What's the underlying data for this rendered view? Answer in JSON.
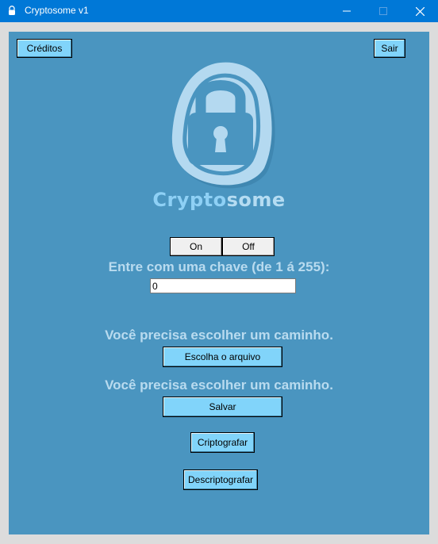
{
  "window": {
    "title": "Cryptosome v1",
    "minimize_glyph": "—",
    "close_glyph": "✕"
  },
  "toolbar": {
    "credits_label": "Créditos",
    "exit_label": "Sair"
  },
  "logo": {
    "icon": "padlock-icon",
    "brand_part1": "Crypto",
    "brand_part2": "some"
  },
  "mode_toggle": {
    "on_label": "On",
    "off_label": "Off"
  },
  "key": {
    "prompt": "Entre com uma chave (de 1 á 255):",
    "value": "0"
  },
  "source": {
    "status": "Você precisa escolher um caminho.",
    "button_label": "Escolha o arquivo"
  },
  "destination": {
    "status": "Você precisa escolher um caminho.",
    "button_label": "Salvar"
  },
  "actions": {
    "encrypt_label": "Criptografar",
    "decrypt_label": "Descriptografar"
  },
  "colors": {
    "background": "#4a95c0",
    "button": "#81d4fa",
    "titlebar": "#0078d7",
    "label_text": "#b9dbef"
  }
}
